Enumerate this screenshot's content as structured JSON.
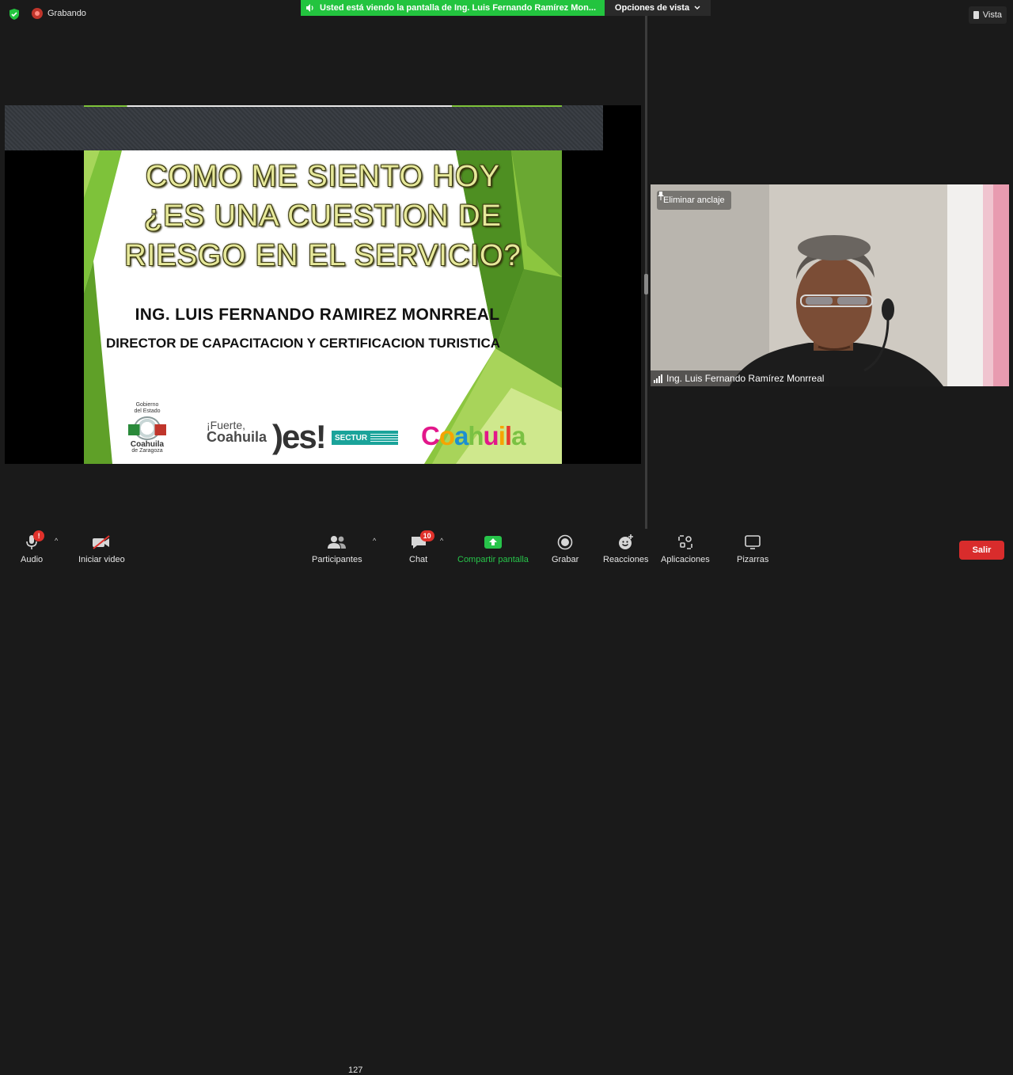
{
  "top": {
    "recording_label": "Grabando",
    "share_banner": "Usted está viendo la pantalla de Ing. Luis Fernando Ramírez Mon...",
    "view_options": "Opciones de vista",
    "view_button": "Vista"
  },
  "slide": {
    "title_line1": "COMO ME SIENTO HOY",
    "title_line2": "¿ES UNA CUESTION DE",
    "title_line3": "RIESGO EN EL SERVICIO?",
    "author": "ING. LUIS FERNANDO RAMIREZ MONRREAL",
    "role": "DIRECTOR DE CAPACITACION Y CERTIFICACION TURISTICA",
    "logos": {
      "gob_line1": "Gobierno",
      "gob_line2": "del Estado",
      "gob_name": "Coahuila",
      "gob_sub": "de Zaragoza",
      "fuerte_line1": "¡Fuerte,",
      "fuerte_line2": "Coahuila",
      "es": ")es!",
      "sector": "SECTUR",
      "brand_letters": [
        "C",
        "o",
        "a",
        "h",
        "u",
        "i",
        "l",
        "a"
      ]
    }
  },
  "participant": {
    "unpin_label": "Eliminar anclaje",
    "name": "Ing. Luis Fernando Ramírez Monrreal"
  },
  "toolbar": {
    "audio_label": "Audio",
    "audio_badge": "!",
    "video_label": "Iniciar video",
    "participants_label": "Participantes",
    "participants_count": "127",
    "chat_label": "Chat",
    "chat_badge": "10",
    "share_label": "Compartir pantalla",
    "record_label": "Grabar",
    "reactions_label": "Reacciones",
    "apps_label": "Aplicaciones",
    "whiteboards_label": "Pizarras",
    "leave_label": "Salir"
  },
  "colors": {
    "banner_green": "#23c43f",
    "share_green": "#27c44a",
    "leave_red": "#d92c2c",
    "badge_red": "#e0312b",
    "slide_green": "#7ec23a"
  },
  "icons": [
    "shield-icon",
    "record-icon",
    "speaker-icon",
    "chevron-down-icon",
    "view-icon",
    "pin-icon",
    "signal-icon",
    "microphone-icon",
    "video-off-icon",
    "participants-icon",
    "chat-icon",
    "share-screen-icon",
    "record-button-icon",
    "reactions-icon",
    "apps-icon",
    "whiteboard-icon"
  ]
}
